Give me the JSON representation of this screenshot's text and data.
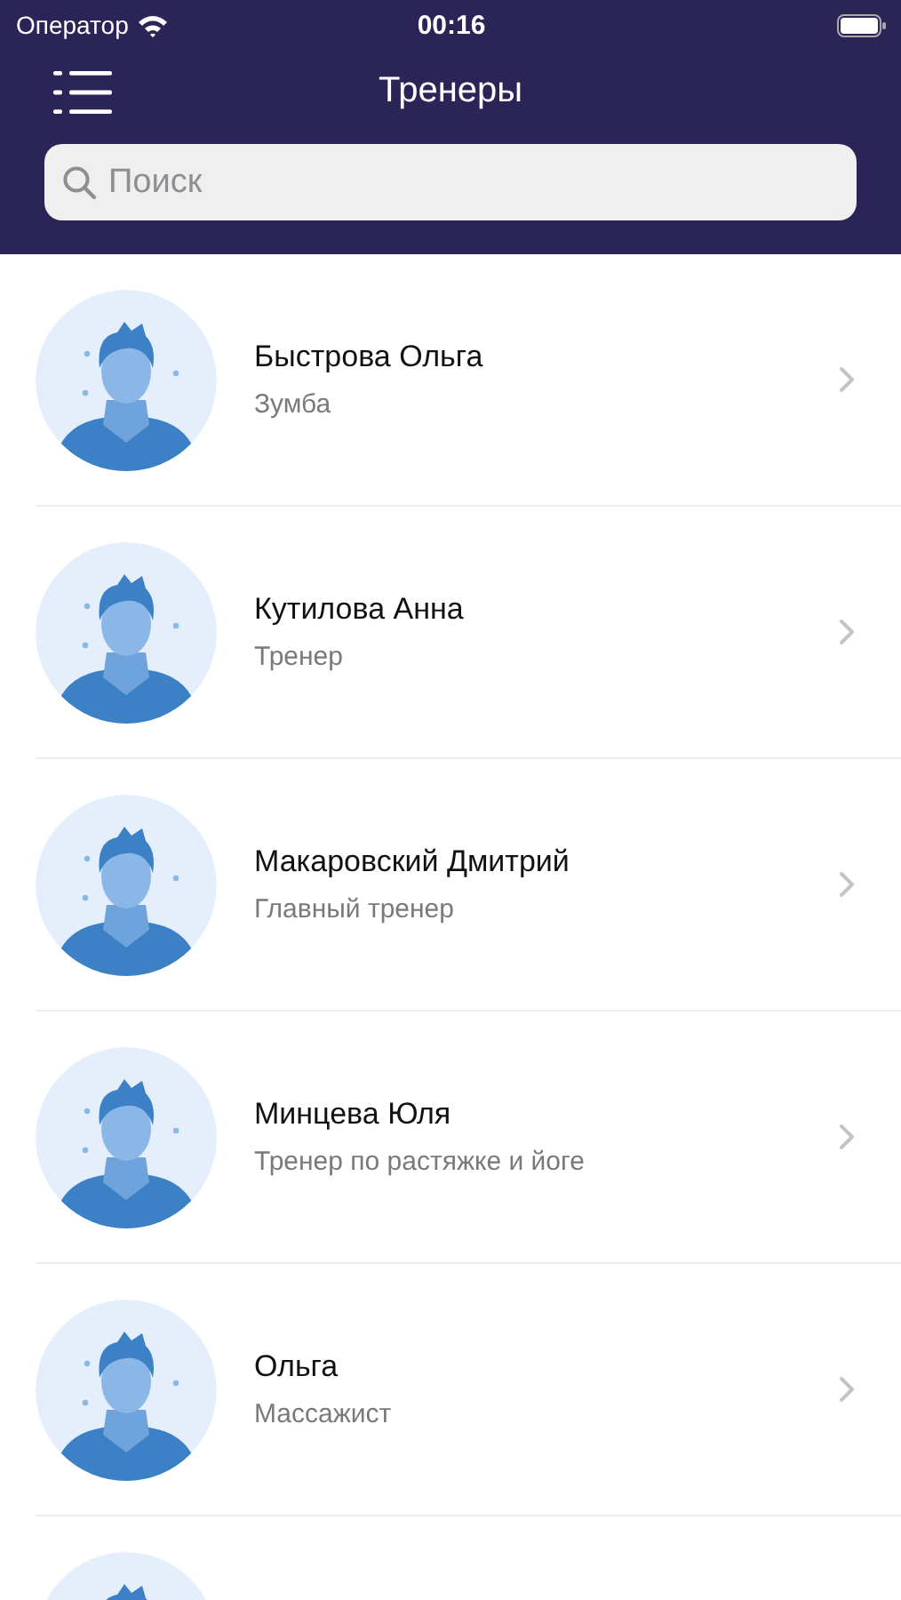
{
  "status_bar": {
    "carrier": "Оператор",
    "time": "00:16"
  },
  "nav": {
    "title": "Тренеры"
  },
  "search": {
    "placeholder": "Поиск"
  },
  "trainers": [
    {
      "name": "Быстрова Ольга",
      "role": "Зумба"
    },
    {
      "name": "Кутилова Анна",
      "role": "Тренер"
    },
    {
      "name": "Макаровский Дмитрий",
      "role": "Главный тренер"
    },
    {
      "name": "Минцева Юля",
      "role": "Тренер по растяжке и йоге"
    },
    {
      "name": "Ольга",
      "role": "Массажист"
    }
  ]
}
